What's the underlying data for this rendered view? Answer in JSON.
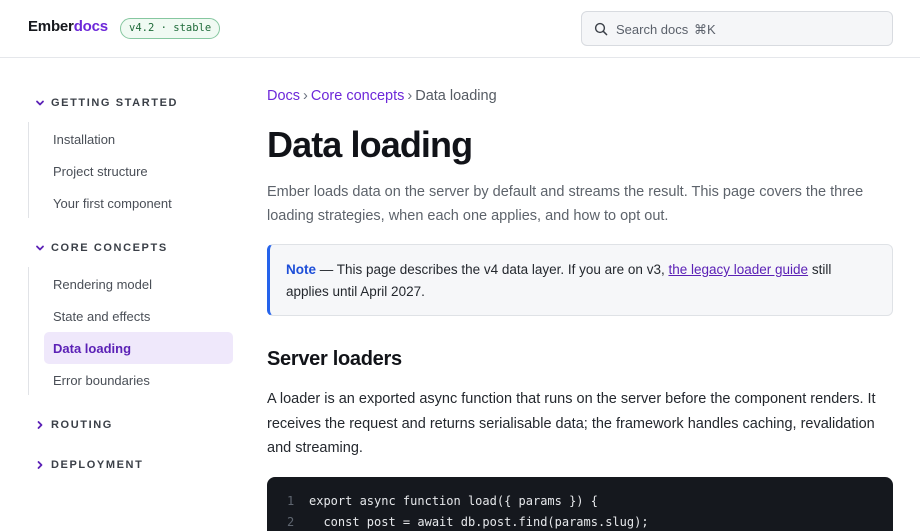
{
  "header": {
    "logo_prefix": "Ember",
    "logo_accent": "docs",
    "version": "v4.2 · stable",
    "search": {
      "placeholder": "Search docs",
      "shortcut": "⌘K"
    }
  },
  "sidebar": {
    "sections": [
      {
        "title": "GETTING STARTED",
        "expanded": true,
        "items": [
          "Installation",
          "Project structure",
          "Your first component"
        ]
      },
      {
        "title": "CORE CONCEPTS",
        "expanded": true,
        "items": [
          "Rendering model",
          "State and effects",
          "Data loading",
          "Error boundaries"
        ]
      },
      {
        "title": "ROUTING",
        "expanded": false,
        "items": []
      },
      {
        "title": "DEPLOYMENT",
        "expanded": false,
        "items": []
      }
    ],
    "active_item": "Data loading"
  },
  "main": {
    "breadcrumb": [
      "Docs",
      "Core concepts",
      "Data loading"
    ],
    "breadcrumb_separator": "›",
    "title": "Data loading",
    "intro": "Ember loads data on the server by default and streams the result. This page covers the three loading strategies, when each one applies, and how to opt out.",
    "note": {
      "label": "Note",
      "text_before": " — This page describes the v4 data layer. If you are on v3, ",
      "link": "the legacy loader guide",
      "text_after": " still applies until April 2027."
    },
    "section_heading": "Server loaders",
    "paragraph": "A loader is an exported async function that runs on the server before the component renders. It receives the request and returns serialisable data; the framework handles caching, revalidation and streaming.",
    "code": {
      "lines": [
        {
          "n": "1",
          "text": "export async function load({ params }) {"
        },
        {
          "n": "2",
          "text": "  const post = await db.post.find(params.slug);"
        }
      ]
    }
  },
  "colors": {
    "accent": "#6d28d9",
    "note_border": "#2563eb",
    "badge_green": "#1f6b3a",
    "code_bg": "#15181e"
  },
  "icons": {
    "search": "search-icon",
    "expanded": "chevron-down-icon",
    "collapsed": "chevron-right-icon"
  }
}
